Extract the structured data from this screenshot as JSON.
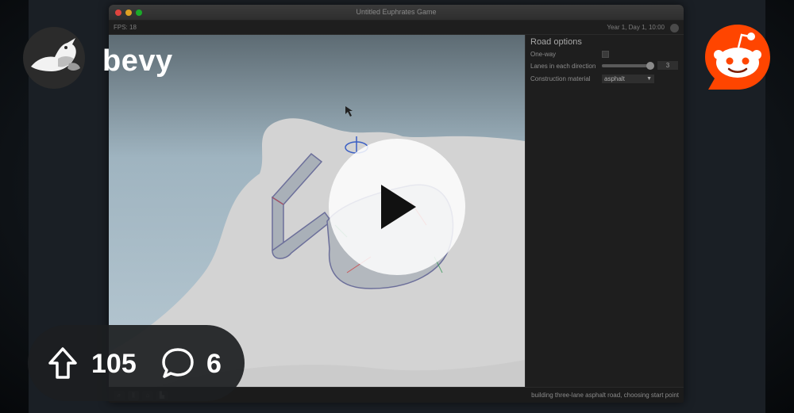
{
  "community": {
    "name": "bevy",
    "avatar_icon": "bevy-bird-logo-icon"
  },
  "platform": {
    "logo_icon": "reddit-snoo-icon",
    "brand_color": "#FF4500"
  },
  "stats": {
    "upvotes": "105",
    "comments": "6",
    "upvote_icon": "upvote-arrow-icon",
    "comment_icon": "comment-bubble-icon"
  },
  "video": {
    "play_icon": "play-icon",
    "app": {
      "window_title": "Untitled Euphrates Game",
      "fps": "FPS: 18",
      "clock": "Year 1, Day 1, 10:00",
      "panel": {
        "title": "Road options",
        "one_way_label": "One-way",
        "one_way_checked": false,
        "lanes_label": "Lanes in each direction",
        "lanes_value": "3",
        "lanes_fraction": 0.95,
        "material_label": "Construction material",
        "material_value": "asphalt"
      },
      "toolbar_icons": [
        "search-icon",
        "road-tool-icon",
        "house-icon",
        "factory-icon"
      ],
      "status": "building three-lane asphalt road, choosing start point"
    }
  }
}
